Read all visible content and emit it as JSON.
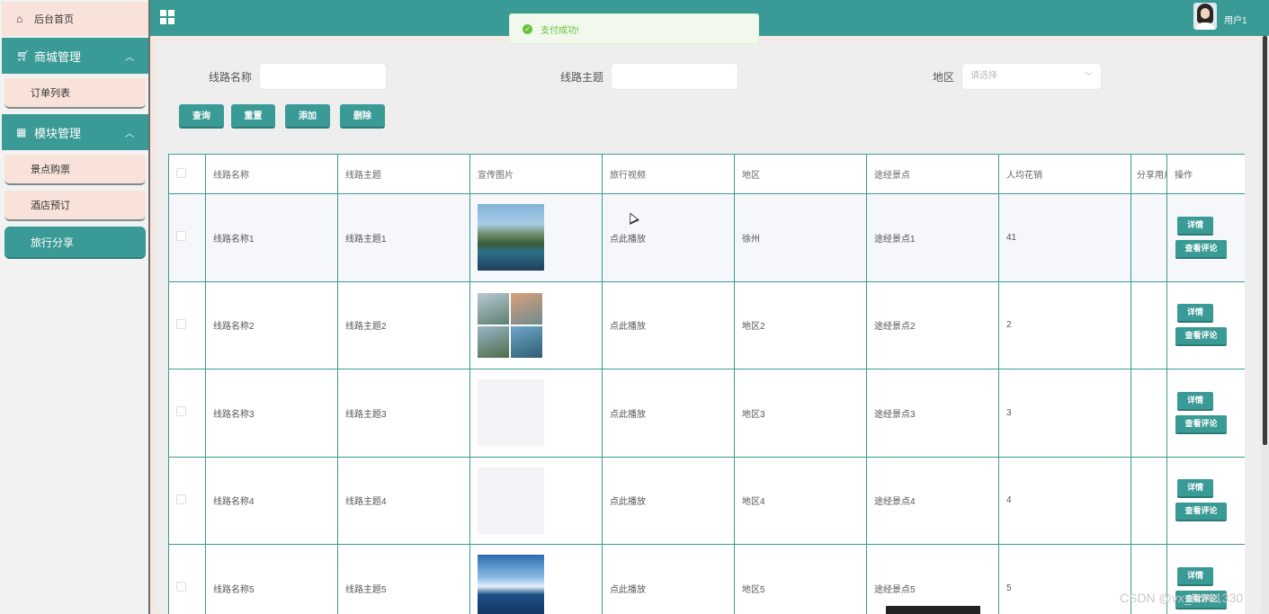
{
  "sidebar": {
    "home": {
      "label": "后台首页",
      "icon": "home-icon"
    },
    "groups": [
      {
        "label": "商城管理",
        "icon": "cart-icon",
        "items": [
          "订单列表"
        ]
      },
      {
        "label": "模块管理",
        "icon": "grid-icon",
        "items": [
          "景点购票",
          "酒店预订",
          "旅行分享"
        ]
      }
    ],
    "active_item": "旅行分享"
  },
  "header": {
    "title": "",
    "user": "用户1"
  },
  "toast": {
    "message": "支付成功!",
    "color": "#67c23a"
  },
  "search": {
    "route_name_label": "线路名称",
    "route_theme_label": "线路主题",
    "region_label": "地区",
    "region_placeholder": "请选择"
  },
  "buttons": {
    "query": "查询",
    "reset": "重置",
    "add": "添加",
    "delete": "删除"
  },
  "table": {
    "columns": [
      "线路名称",
      "线路主题",
      "宣传图片",
      "旅行视频",
      "地区",
      "途经景点",
      "人均花销",
      "分享用户",
      "操作"
    ],
    "rows": [
      {
        "name": "线路名称1",
        "theme": "线路主题1",
        "video": "点此播放",
        "region": "徐州",
        "spots": "途经景点1",
        "cost": "41"
      },
      {
        "name": "线路名称2",
        "theme": "线路主题2",
        "video": "点此播放",
        "region": "地区2",
        "spots": "途经景点2",
        "cost": "2"
      },
      {
        "name": "线路名称3",
        "theme": "线路主题3",
        "video": "点此播放",
        "region": "地区3",
        "spots": "途经景点3",
        "cost": "3"
      },
      {
        "name": "线路名称4",
        "theme": "线路主题4",
        "video": "点此播放",
        "region": "地区4",
        "spots": "途经景点4",
        "cost": "4"
      },
      {
        "name": "线路名称5",
        "theme": "线路主题5",
        "video": "点此播放",
        "region": "地区5",
        "spots": "途经景点5",
        "cost": "5"
      }
    ],
    "detail_label": "详情",
    "comment_label": "查看评论"
  },
  "watermark": "CSDN @vx_BS81330",
  "colors": {
    "primary": "#3a9a95",
    "sidebar_item_bg": "#f8e2da",
    "success": "#67c23a"
  }
}
